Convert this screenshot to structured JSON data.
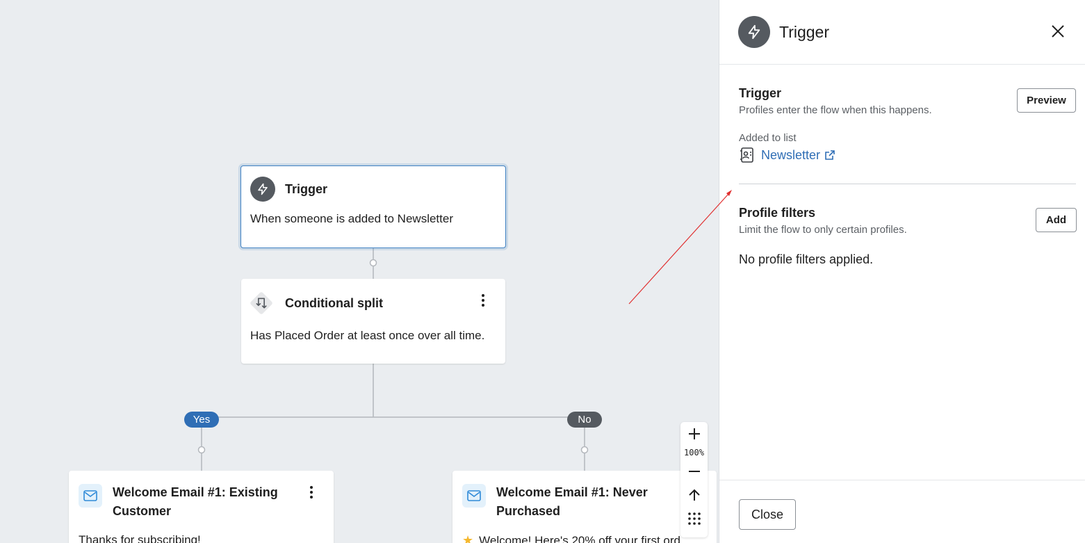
{
  "canvas": {
    "trigger_node": {
      "title": "Trigger",
      "description": "When someone is added to Newsletter"
    },
    "split_node": {
      "title": "Conditional split",
      "description": "Has Placed Order at least once over all time."
    },
    "branches": {
      "yes_label": "Yes",
      "no_label": "No",
      "yes_color": "#2f6eb5",
      "no_color": "#555a60"
    },
    "email_nodes": [
      {
        "title_line1": "Welcome Email #1: Existing",
        "title_line2": "Customer",
        "preview": "Thanks for subscribing!"
      },
      {
        "title_line1": "Welcome Email #1: Never",
        "title_line2": "Purchased",
        "preview": "Welcome! Here's 20% off your first ord"
      }
    ],
    "zoom": {
      "level": "100%",
      "icons": [
        "plus-icon",
        "minus-icon",
        "arrow-up-icon",
        "grid-dots-icon"
      ]
    }
  },
  "panel": {
    "header_title": "Trigger",
    "trigger_section": {
      "title": "Trigger",
      "subtitle": "Profiles enter the flow when this happens.",
      "preview_label": "Preview",
      "list_label": "Added to list",
      "list_name": "Newsletter"
    },
    "filters_section": {
      "title": "Profile filters",
      "subtitle": "Limit the flow to only certain profiles.",
      "add_label": "Add",
      "empty_text": "No profile filters applied."
    },
    "footer": {
      "close_label": "Close"
    }
  },
  "colors": {
    "accent": "#2f6eb5",
    "canvas_bg": "#eaedf0",
    "annotation_arrow": "#e03030"
  }
}
